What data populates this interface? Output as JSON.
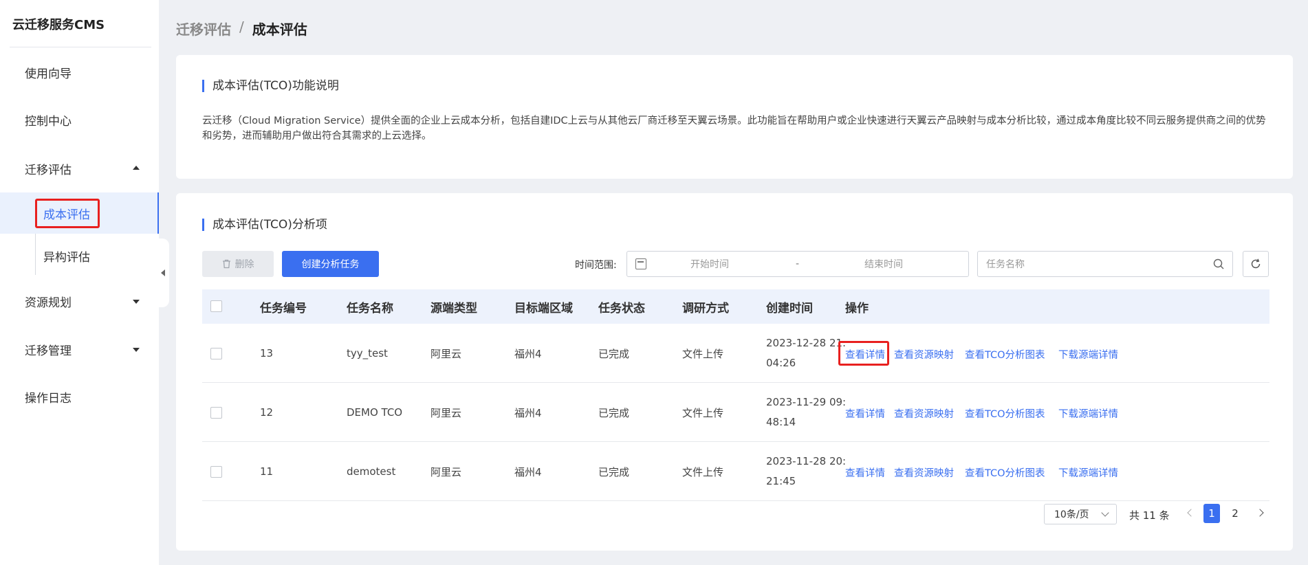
{
  "sidebar": {
    "brand": "云迁移服务CMS",
    "items": [
      {
        "label": "使用向导"
      },
      {
        "label": "控制中心"
      },
      {
        "label": "迁移评估"
      },
      {
        "label": "资源规划"
      },
      {
        "label": "迁移管理"
      },
      {
        "label": "操作日志"
      }
    ],
    "sub_items": [
      {
        "label": "成本评估",
        "active": true
      },
      {
        "label": "异构评估",
        "active": false
      }
    ]
  },
  "breadcrumb": {
    "parent": "迁移评估",
    "separator": "/",
    "current": "成本评估"
  },
  "description": {
    "title": "成本评估(TCO)功能说明",
    "text": "云迁移（Cloud Migration Service）提供全面的企业上云成本分析，包括自建IDC上云与从其他云厂商迁移至天翼云场景。此功能旨在帮助用户或企业快速进行天翼云产品映射与成本分析比较，通过成本角度比较不同云服务提供商之间的优势和劣势，进而辅助用户做出符合其需求的上云选择。"
  },
  "analysis": {
    "title": "成本评估(TCO)分析项",
    "delete_label": "删除",
    "create_label": "创建分析任务",
    "range_label": "时间范围:",
    "start_placeholder": "开始时间",
    "range_dash": "-",
    "end_placeholder": "结束时间",
    "search_placeholder": "任务名称"
  },
  "table": {
    "headers": [
      "任务编号",
      "任务名称",
      "源端类型",
      "目标端区域",
      "任务状态",
      "调研方式",
      "创建时间",
      "操作"
    ],
    "rows": [
      {
        "id": "13",
        "name": "tyy_test",
        "source": "阿里云",
        "region": "福州4",
        "status": "已完成",
        "method": "文件上传",
        "created": "2023-12-28 21:04:26"
      },
      {
        "id": "12",
        "name": "DEMO TCO",
        "source": "阿里云",
        "region": "福州4",
        "status": "已完成",
        "method": "文件上传",
        "created": "2023-11-29 09:48:14"
      },
      {
        "id": "11",
        "name": "demotest",
        "source": "阿里云",
        "region": "福州4",
        "status": "已完成",
        "method": "文件上传",
        "created": "2023-11-28 20:21:45"
      }
    ],
    "actions": [
      "查看详情",
      "查看资源映射",
      "查看TCO分析图表",
      "下载源端详情"
    ]
  },
  "pagination": {
    "page_size": "10条/页",
    "total": "共 11 条",
    "pages": [
      "1",
      "2"
    ],
    "current": "1"
  },
  "colors": {
    "accent": "#3a6ff0",
    "highlight": "#e8201f"
  }
}
